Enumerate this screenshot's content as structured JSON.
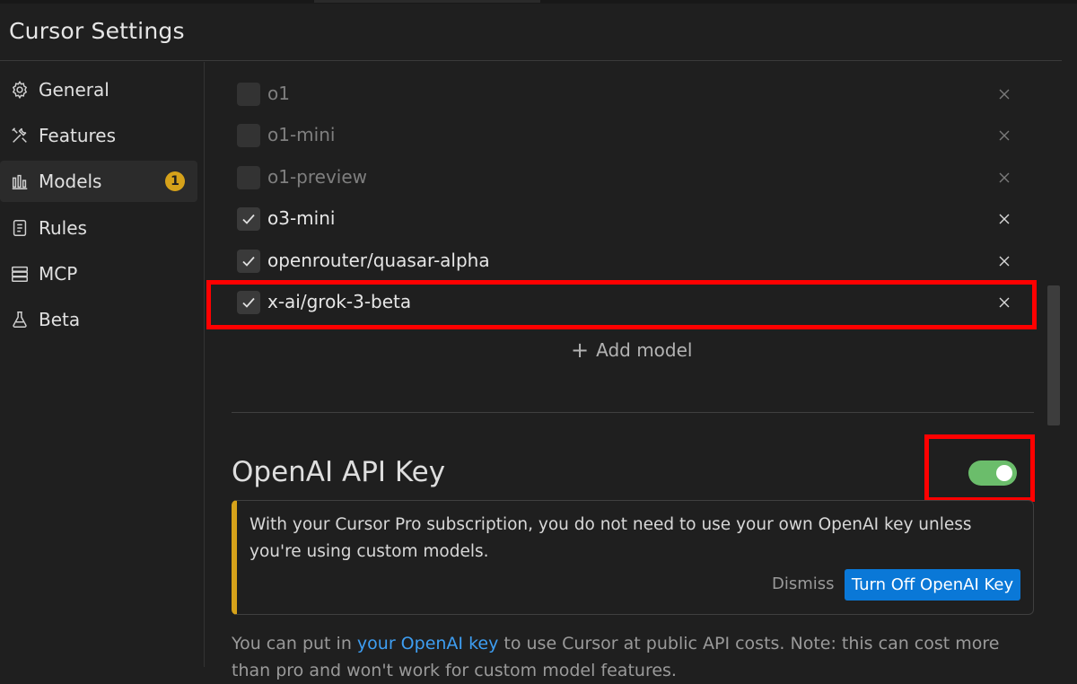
{
  "header": {
    "title": "Cursor Settings"
  },
  "sidebar": {
    "items": [
      {
        "label": "General",
        "icon": "gear-icon"
      },
      {
        "label": "Features",
        "icon": "tools-icon"
      },
      {
        "label": "Models",
        "icon": "bar-chart-icon",
        "badge": "1",
        "active": true
      },
      {
        "label": "Rules",
        "icon": "document-icon"
      },
      {
        "label": "MCP",
        "icon": "server-icon"
      },
      {
        "label": "Beta",
        "icon": "flask-icon"
      }
    ]
  },
  "models": [
    {
      "name": "o1",
      "checked": false
    },
    {
      "name": "o1-mini",
      "checked": false
    },
    {
      "name": "o1-preview",
      "checked": false
    },
    {
      "name": "o3-mini",
      "checked": true
    },
    {
      "name": "openrouter/quasar-alpha",
      "checked": true
    },
    {
      "name": "x-ai/grok-3-beta",
      "checked": true
    }
  ],
  "add_model_label": "Add model",
  "openai": {
    "title": "OpenAI API Key",
    "toggle_on": true,
    "notice_text": "With your Cursor Pro subscription, you do not need to use your own OpenAI key unless you're using custom models.",
    "dismiss_label": "Dismiss",
    "turn_off_label": "Turn Off OpenAI Key",
    "footer_prefix": "You can put in ",
    "footer_link": "your OpenAI key",
    "footer_suffix": " to use Cursor at public API costs. Note: this can cost more than pro and won't work for custom model features."
  },
  "colors": {
    "accent_blue": "#0a78d7",
    "toggle_green": "#6bbd6b",
    "badge_yellow": "#d6a21a",
    "highlight_red": "#ff0000"
  }
}
